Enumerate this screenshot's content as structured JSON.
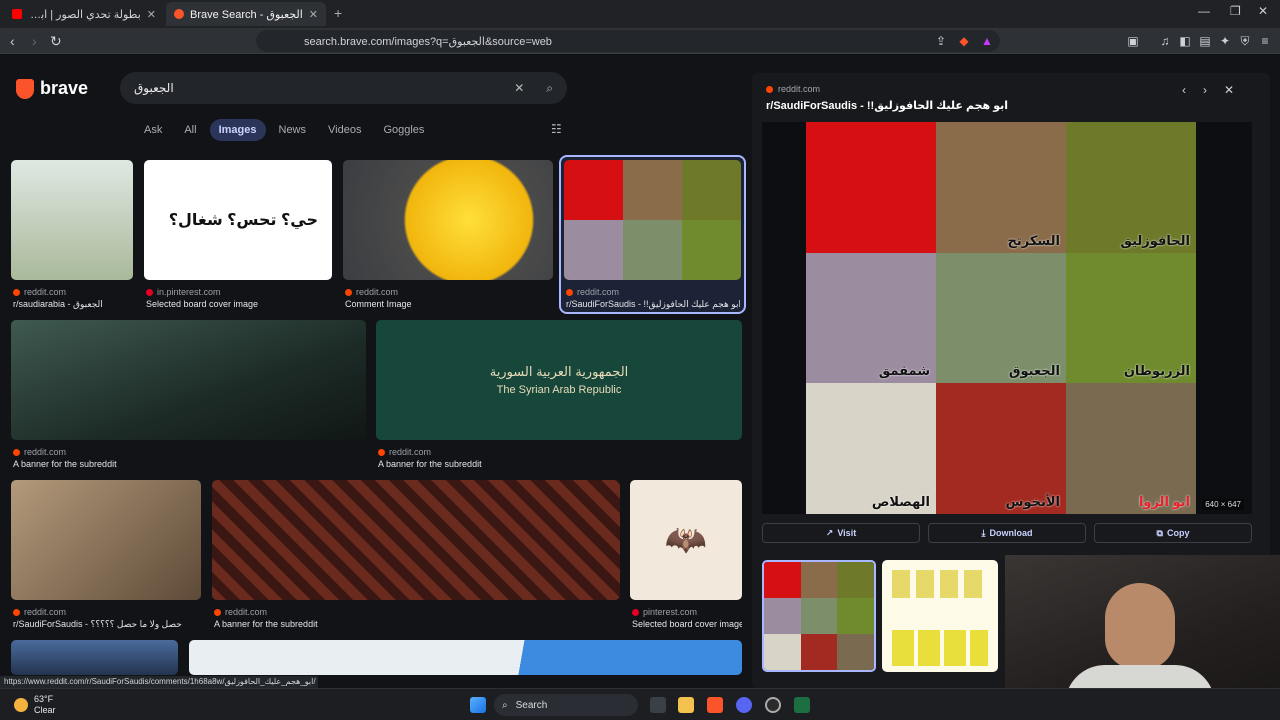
{
  "browser": {
    "tabs": [
      {
        "title": "بطولة تحدي الصور | ابو السعد و ح...",
        "active": false,
        "favicon_color": "#ff0000"
      },
      {
        "title": "Brave Search - الجعبوق",
        "active": true,
        "favicon_color": "#fb542b"
      }
    ],
    "new_tab_icon": "plus-icon",
    "window_controls": [
      "minimize-icon",
      "restore-icon",
      "close-icon"
    ],
    "url": "search.brave.com/images?q=الجعبوق&source=web"
  },
  "search": {
    "logo_text": "brave",
    "query": "الجعبوق",
    "tabs": [
      "Ask",
      "All",
      "Images",
      "News",
      "Videos",
      "Goggles"
    ],
    "active_tab": "Images"
  },
  "results": [
    {
      "source": "reddit.com",
      "caption": "r/saudiarabia - الجعبوق",
      "bg": "#cfd9d0",
      "site": "reddit"
    },
    {
      "source": "in.pinterest.com",
      "caption": "Selected board cover image",
      "bg": "#ffffff",
      "site": "pinterest",
      "image_text": "حي؟ تحس؟ شغال؟"
    },
    {
      "source": "reddit.com",
      "caption": "Comment Image",
      "bg": "#e8c21a",
      "site": "reddit"
    },
    {
      "source": "reddit.com",
      "caption": "r/SaudiForSaudis - !!ابو هجم عليك الحافوزليق",
      "bg": "#6a4a50",
      "site": "reddit"
    },
    {
      "source": "reddit.com",
      "caption": "A banner for the subreddit",
      "bg": "#243a34",
      "site": "reddit"
    },
    {
      "source": "reddit.com",
      "caption": "A banner for the subreddit",
      "bg": "#17463a",
      "site": "reddit",
      "banner_ar": "الجمهورية العربية السورية",
      "banner_en": "The Syrian Arab Republic"
    },
    {
      "source": "reddit.com",
      "caption": "r/SaudiForSaudis - حصل ولا ما حصل ؟؟؟؟؟",
      "bg": "#8a6f55",
      "site": "reddit"
    },
    {
      "source": "reddit.com",
      "caption": "A banner for the subreddit",
      "bg": "#6b2a1e",
      "site": "reddit"
    },
    {
      "source": "pinterest.com",
      "caption": "Selected board cover image",
      "bg": "#f2e9dc",
      "site": "pinterest"
    }
  ],
  "preview": {
    "source": "reddit.com",
    "title": "r/SaudiForSaudis - !!ابو هجم عليك الحافوزليق",
    "cells": [
      {
        "label": "",
        "color": "#d60f12"
      },
      {
        "label": "السكرتح",
        "color": "#8a6b4a"
      },
      {
        "label": "الحافوزليق",
        "color": "#6e7a2a"
      },
      {
        "label": "شمقمق",
        "color": "#9c8ca0"
      },
      {
        "label": "الجعبوق",
        "color": "#7c8f6a"
      },
      {
        "label": "الزربوطان",
        "color": "#6f8b2e"
      },
      {
        "label": "الهصلاص",
        "color": "#d8d4c8"
      },
      {
        "label": "الأنخوس",
        "color": "#a32a20"
      },
      {
        "label": "ابو الزوا",
        "color": "#7a6a50"
      }
    ],
    "dimensions": "640 × 647",
    "actions": [
      "Visit",
      "Download",
      "Copy"
    ]
  },
  "status_url": "https://www.reddit.com/r/SaudiForSaudis/comments/1h68a8w/ابو_هجم_عليك_الحافوزليق/",
  "taskbar": {
    "temperature": "63°F",
    "condition": "Clear",
    "search_label": "Search"
  }
}
